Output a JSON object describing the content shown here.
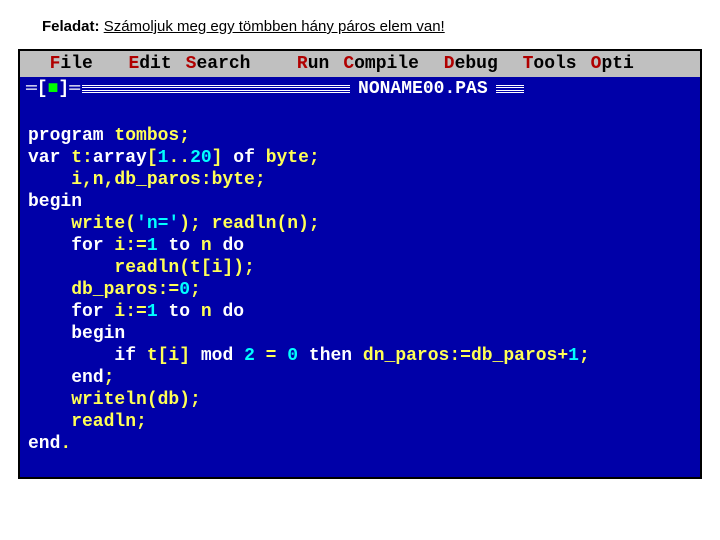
{
  "task": {
    "prefix": "Feladat:",
    "text": "Számoljuk meg egy tömbben hány páros elem van!"
  },
  "menu": {
    "file": {
      "hot": "F",
      "rest": "ile"
    },
    "edit": {
      "hot": "E",
      "rest": "dit"
    },
    "search": {
      "hot": "S",
      "rest": "earch"
    },
    "run": {
      "hot": "R",
      "rest": "un"
    },
    "compile": {
      "hot": "C",
      "rest": "ompile"
    },
    "debug": {
      "hot": "D",
      "rest": "ebug"
    },
    "tools": {
      "hot": "T",
      "rest": "ools"
    },
    "options": {
      "hot": "O",
      "rest": "pti"
    }
  },
  "titlebar": {
    "control_open": "═[",
    "control_close": "]═",
    "control_glyph": "■",
    "filename": " NONAME00.PAS "
  },
  "code": {
    "l01": {
      "kw1": "program",
      "rest": " tombos;"
    },
    "l02": {
      "kw1": "var",
      "a": " t:",
      "kw2": "array",
      "b": "[",
      "n1": "1",
      "c": "..",
      "n2": "20",
      "d": "] ",
      "kw3": "of",
      "e": " byte;"
    },
    "l03": {
      "a": "    i,n,db_paros:byte;"
    },
    "l04": {
      "kw1": "begin"
    },
    "l05": {
      "a": "    write(",
      "s": "'n='",
      "b": "); readln(n);"
    },
    "l06": {
      "a": "    ",
      "kw1": "for",
      "b": " i:=",
      "n1": "1",
      "c": " ",
      "kw2": "to",
      "d": " n ",
      "kw3": "do"
    },
    "l07": {
      "a": "        readln(t[i]);"
    },
    "l08": {
      "a": "    db_paros:=",
      "n1": "0",
      "b": ";"
    },
    "l09": {
      "a": "    ",
      "kw1": "for",
      "b": " i:=",
      "n1": "1",
      "c": " ",
      "kw2": "to",
      "d": " n ",
      "kw3": "do"
    },
    "l10": {
      "a": "    ",
      "kw1": "begin"
    },
    "l11": {
      "a": "        ",
      "kw1": "if",
      "b": " t[i] ",
      "kw2": "mod",
      "c": " ",
      "n1": "2",
      "d": " = ",
      "n2": "0",
      "e": " ",
      "kw3": "then",
      "f": " dn_paros:=db_paros+",
      "n3": "1",
      "g": ";"
    },
    "l12": {
      "a": "    ",
      "kw1": "end",
      "b": ";"
    },
    "l13": {
      "a": "    writeln(db);"
    },
    "l14": {
      "a": "    readln;"
    },
    "l15": {
      "kw1": "end",
      "a": "."
    }
  }
}
